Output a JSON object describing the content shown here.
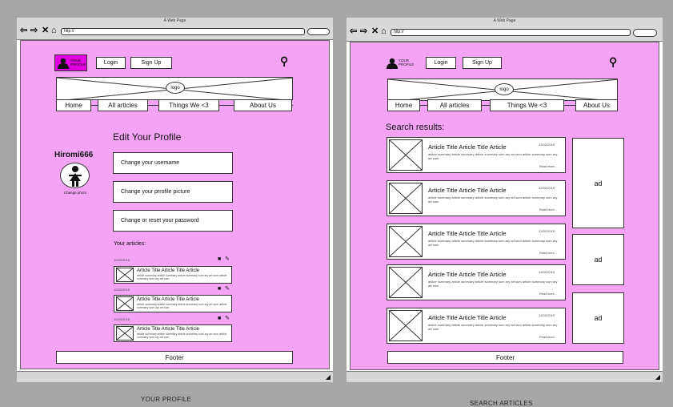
{
  "left": {
    "window_title": "A Web Page",
    "url": "http://",
    "profile_btn": "YOUR PROFILE",
    "login": "Login",
    "signup": "Sign Up",
    "logo": "logo",
    "nav": [
      "Home",
      "All articles",
      "Things We <3",
      "About Us"
    ],
    "heading": "Edit Your Profile",
    "username": "Hiromi666",
    "change_photo": "Change photo",
    "actions": [
      "Change your username",
      "Change your prrofile picture",
      "Change or reset your password"
    ],
    "articles_label": "Your articles:",
    "articles": [
      {
        "date": "12/02/2015",
        "title": "Article Title Article Title Article",
        "summary": "article summary article summary article summary sum ary art sum article summary sum ary art sum"
      },
      {
        "date": "12/02/2015",
        "title": "Article Title Article Title Article",
        "summary": "article summary article summary article summary sum ary art sum article summary sum ary art sum"
      },
      {
        "date": "12/02/2015",
        "title": "Article Title Article Title Article",
        "summary": "article summary article summary article summary sum ary art sum article summary sum ary art sum"
      }
    ],
    "footer": "Footer",
    "caption": "YOUR PROFILE"
  },
  "right": {
    "window_title": "A Web Page",
    "url": "http://",
    "profile_btn": "YOUR PROFILE",
    "login": "Login",
    "signup": "Sign Up",
    "logo": "logo",
    "nav": [
      "Home",
      "All articles",
      "Things We <3",
      "About Us"
    ],
    "results_label": "Search results:",
    "results": [
      {
        "title": "Article Title Article Title Article",
        "date": "12/02/2015",
        "summary": "article summary article summary article summary sum ary art sum article summary sum ary art sum",
        "more": "Read more..."
      },
      {
        "title": "Article Title Article Title Article",
        "date": "12/02/2015",
        "summary": "article summary article summary article summary sum ary art sum article summary sum ary art sum",
        "more": "Read more..."
      },
      {
        "title": "Article Title Article Title Article",
        "date": "12/02/2015",
        "summary": "article summary article summary article summary sum ary art sum article summary sum ary art sum",
        "more": "Read more..."
      },
      {
        "title": "Article Title Article Title Article",
        "date": "12/02/2015",
        "summary": "article summary article summary article summary sum ary art sum article summary sum ary art sum",
        "more": "Read more..."
      },
      {
        "title": "Article Title Article Title Article",
        "date": "12/02/2015",
        "summary": "article summary article summary article summary sum ary art sum article summary sum ary art sum",
        "more": "Read more..."
      }
    ],
    "ads": [
      "ad",
      "ad",
      "ad"
    ],
    "footer": "Footer",
    "caption": "SEARCH ARTICLES"
  },
  "colors": {
    "canvas": "#f5a4f5",
    "profile_active": "#e000e0",
    "backdrop": "#a7a7a7"
  }
}
